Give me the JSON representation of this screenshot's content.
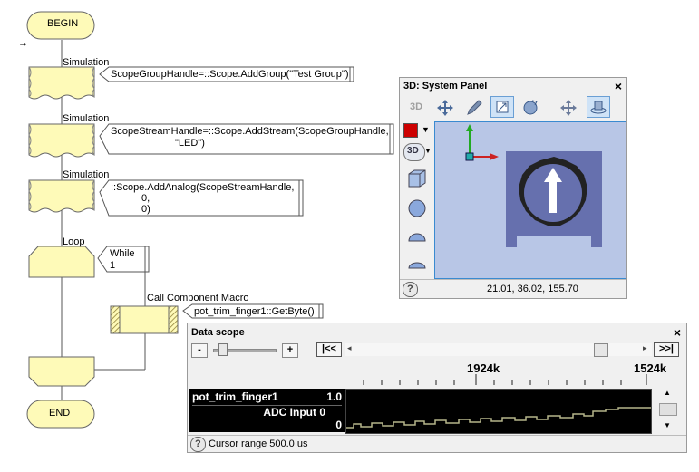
{
  "flowchart": {
    "begin_label": "BEGIN",
    "end_label": "END",
    "step1": {
      "type_label": "Simulation",
      "code": "ScopeGroupHandle=::Scope.AddGroup(\"Test Group\")"
    },
    "step2": {
      "type_label": "Simulation",
      "code_line1": "ScopeStreamHandle=::Scope.AddStream(ScopeGroupHandle,",
      "code_line2": "\"LED\")"
    },
    "step3": {
      "type_label": "Simulation",
      "code_line1": "::Scope.AddAnalog(ScopeStreamHandle,",
      "code_line2": "0,",
      "code_line3": "0)"
    },
    "loop": {
      "type_label": "Loop",
      "condition_line1": "While",
      "condition_line2": "1"
    },
    "macro": {
      "type_label": "Call Component Macro",
      "code": "pot_trim_finger1::GetByte()"
    }
  },
  "system_panel": {
    "title": "3D: System Panel",
    "toolbar": [
      "3d-label",
      "move-icon",
      "pencil-icon",
      "resize-icon",
      "rotate-icon",
      "pan-icon",
      "camera-orbit-icon"
    ],
    "toolbar_3d_label": "3D",
    "view_3d_button": "3D",
    "accent_color": "#cc0000",
    "canvas_bg": "#b8c6e6",
    "coordinates": "21.01, 36.02, 155.70",
    "help_glyph": "?"
  },
  "data_scope": {
    "title": "Data scope",
    "zoom_out": "-",
    "zoom_in": "+",
    "jump_start": "|<<",
    "jump_end": ">>|",
    "timeline_left": "1924k",
    "timeline_right": "1524k",
    "channel_name": "pot_trim_finger1",
    "channel_max": "1.0",
    "channel_sub": "ADC Input 0",
    "channel_min": "0",
    "status": "Cursor range 500.0 us",
    "trace_color": "#b5b58a",
    "help_glyph": "?"
  }
}
